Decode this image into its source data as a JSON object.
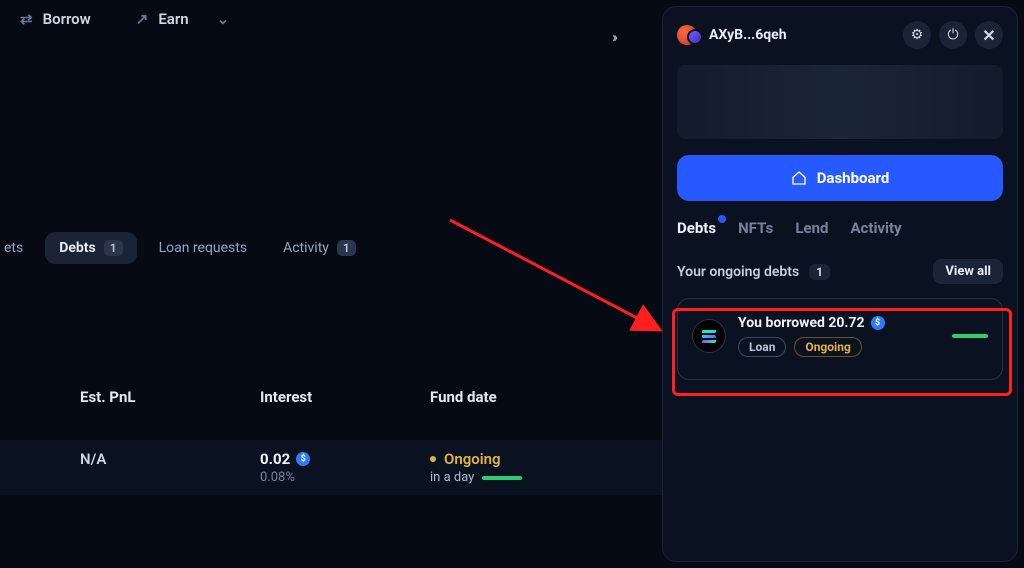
{
  "nav": {
    "borrow": "Borrow",
    "earn": "Earn"
  },
  "mainTabs": {
    "assets_partial": "ets",
    "debts": "Debts",
    "debts_badge": "1",
    "loan_requests": "Loan requests",
    "activity": "Activity",
    "activity_badge": "1"
  },
  "columns": {
    "pnl": "Est. PnL",
    "interest": "Interest",
    "fund": "Fund date"
  },
  "row": {
    "pnl": "N/A",
    "interest_val": "0.02",
    "interest_pct": "0.08%",
    "status": "Ongoing",
    "due": "in a day"
  },
  "panel": {
    "wallet": "AXyB...6qeh",
    "dashboard": "Dashboard",
    "tabs": {
      "debts": "Debts",
      "nfts": "NFTs",
      "lend": "Lend",
      "activity": "Activity"
    },
    "section_title": "Your ongoing debts",
    "section_count": "1",
    "view_all": "View all",
    "debt": {
      "title": "You borrowed 20.72",
      "chip_loan": "Loan",
      "chip_status": "Ongoing"
    }
  },
  "glyphs": {
    "coin": "$"
  }
}
